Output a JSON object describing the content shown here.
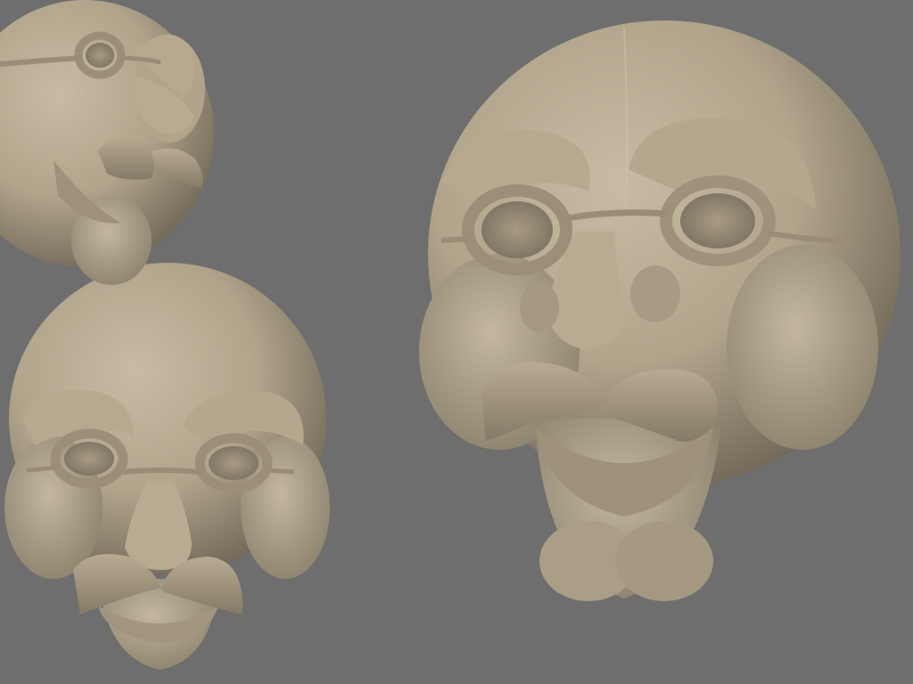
{
  "scene": {
    "background_color": "#6e6e6e",
    "material_color": "#b3a68e",
    "views": [
      {
        "id": "three-quarter-top-left",
        "icon": "clay-head-sculpt"
      },
      {
        "id": "front-bottom-left",
        "icon": "clay-head-sculpt"
      },
      {
        "id": "front-large-right",
        "icon": "clay-head-sculpt"
      }
    ]
  }
}
